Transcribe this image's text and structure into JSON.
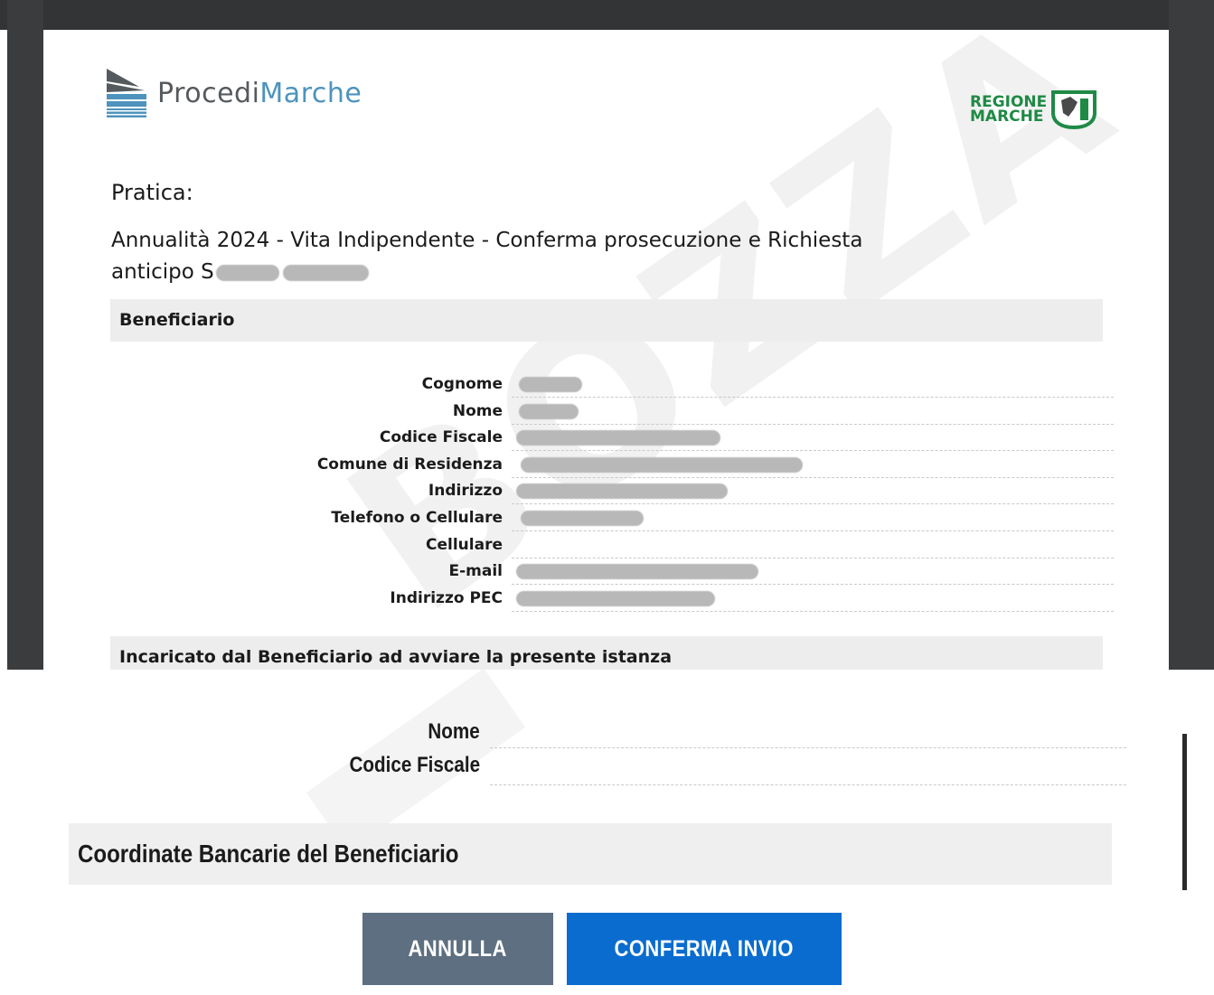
{
  "header": {
    "logo_text_part1": "Procedi",
    "logo_text_part2": "Marche",
    "regione_line1": "REGIONE",
    "regione_line2": "MARCHE"
  },
  "pratica": {
    "label": "Pratica:",
    "title_line1": "Annualità 2024 - Vita Indipendente - Conferma prosecuzione e Richiesta",
    "title_line2_prefix": "anticipo S"
  },
  "sections": {
    "beneficiario": "Beneficiario",
    "incaricato": "Incaricato dal Beneficiario ad avviare la presente istanza",
    "coordinate_bancarie": "Coordinate Bancarie del Beneficiario"
  },
  "beneficiario_fields": [
    {
      "label": "Cognome"
    },
    {
      "label": "Nome"
    },
    {
      "label": "Codice Fiscale"
    },
    {
      "label": "Comune di Residenza"
    },
    {
      "label": "Indirizzo"
    },
    {
      "label": "Telefono o Cellulare"
    },
    {
      "label": "Cellulare"
    },
    {
      "label": "E-mail"
    },
    {
      "label": "Indirizzo PEC"
    }
  ],
  "incaricato_fields": [
    {
      "label": "Nome"
    },
    {
      "label": "Codice Fiscale"
    }
  ],
  "buttons": {
    "annulla": "ANNULLA",
    "conferma": "CONFERMA INVIO"
  },
  "colors": {
    "regione_green": "#1f8a45",
    "logo_blue": "#4d93bd",
    "annulla_bg": "#5d6f81",
    "conferma_bg": "#0a6ccf"
  }
}
